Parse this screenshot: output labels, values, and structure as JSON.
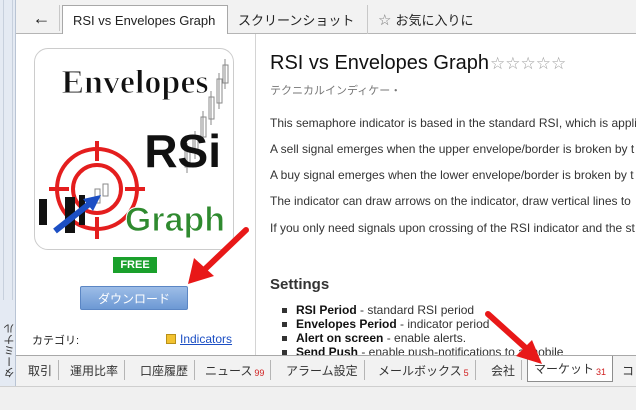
{
  "window": {
    "left_strip_label": "ターミナル"
  },
  "tabbar": {
    "back_icon": "arrow-left-icon",
    "tabs": [
      {
        "label": "RSI vs Envelopes Graph",
        "active": true
      },
      {
        "label": "スクリーンショット",
        "active": false
      },
      {
        "label": "お気に入りに",
        "active": false,
        "icon": "star-outline-icon"
      }
    ]
  },
  "product": {
    "image_text": {
      "line1": "Envelopes",
      "line2": "RSi",
      "line3": "Graph"
    },
    "badge": "FREE",
    "download_label": "ダウンロード",
    "category_label": "カテゴリ:",
    "category_value": "Indicators",
    "title": "RSI vs Envelopes Graph",
    "rating_stars": "☆☆☆☆☆",
    "rating_value": 0,
    "type": "テクニカルインディケー・",
    "description": [
      "This semaphore indicator is based in the standard RSI, which is appli",
      "A sell signal emerges when the upper envelope/border is broken by t",
      "A buy signal emerges when the lower envelope/border is broken by t",
      "The indicator can draw arrows on the indicator, draw vertical lines to",
      "If you only need signals upon crossing of the RSI indicator and the st"
    ],
    "settings_heading": "Settings",
    "settings": [
      {
        "name": "RSI Period",
        "desc": " - standard RSI period"
      },
      {
        "name": "Envelopes Period",
        "desc": " - indicator period"
      },
      {
        "name": "Alert on screen",
        "desc": " - enable alerts."
      },
      {
        "name": "Send Push",
        "desc": " - enable push-notifications to a mobile"
      }
    ]
  },
  "bottombar": {
    "tabs": [
      {
        "label": "取引",
        "count": ""
      },
      {
        "label": "運用比率",
        "count": ""
      },
      {
        "label": "口座履歴",
        "count": ""
      },
      {
        "label": "ニュース",
        "count": "99"
      },
      {
        "label": "アラーム設定",
        "count": ""
      },
      {
        "label": "メールボックス",
        "count": "5"
      },
      {
        "label": "会社",
        "count": ""
      },
      {
        "label": "マーケット",
        "count": "31",
        "active": true
      },
      {
        "label": "コ",
        "count": ""
      }
    ]
  },
  "colors": {
    "free_badge": "#1aa02b",
    "download_button": "#7fa6db",
    "link": "#1c4fc4",
    "count_badge": "#d02020",
    "annotation_arrow": "#e81818"
  }
}
